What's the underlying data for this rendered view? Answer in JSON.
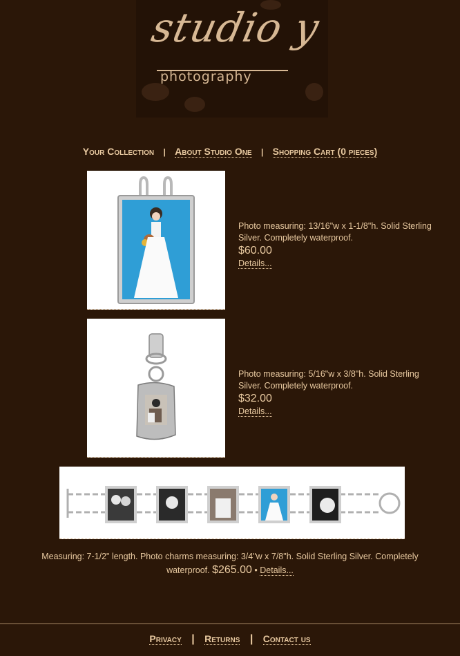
{
  "logo": {
    "script_text": "studio y",
    "sub_text": "photography"
  },
  "nav": {
    "items": [
      {
        "label": "Your Collection"
      },
      {
        "label": "About Studio One"
      },
      {
        "label": "Shopping Cart (0 pieces)"
      }
    ],
    "separator": "|"
  },
  "products": [
    {
      "description": "Photo measuring: 13/16\"w x 1-1/8\"h. Solid Sterling Silver. Completely waterproof.",
      "price": "$60.00",
      "details_label": "Details..."
    },
    {
      "description": "Photo measuring: 5/16\"w x 3/8\"h. Solid Sterling Silver. Completely waterproof.",
      "price": "$32.00",
      "details_label": "Details..."
    }
  ],
  "bracelet": {
    "description": "Measuring: 7-1/2\" length. Photo charms measuring: 3/4\"w x 7/8\"h. Solid Sterling Silver. Completely waterproof.",
    "price": "$265.00",
    "bullet": "•",
    "details_label": "Details..."
  },
  "footer": {
    "links": [
      {
        "label": "Privacy"
      },
      {
        "label": "Returns"
      },
      {
        "label": "Contact us"
      }
    ],
    "separator": "|"
  }
}
